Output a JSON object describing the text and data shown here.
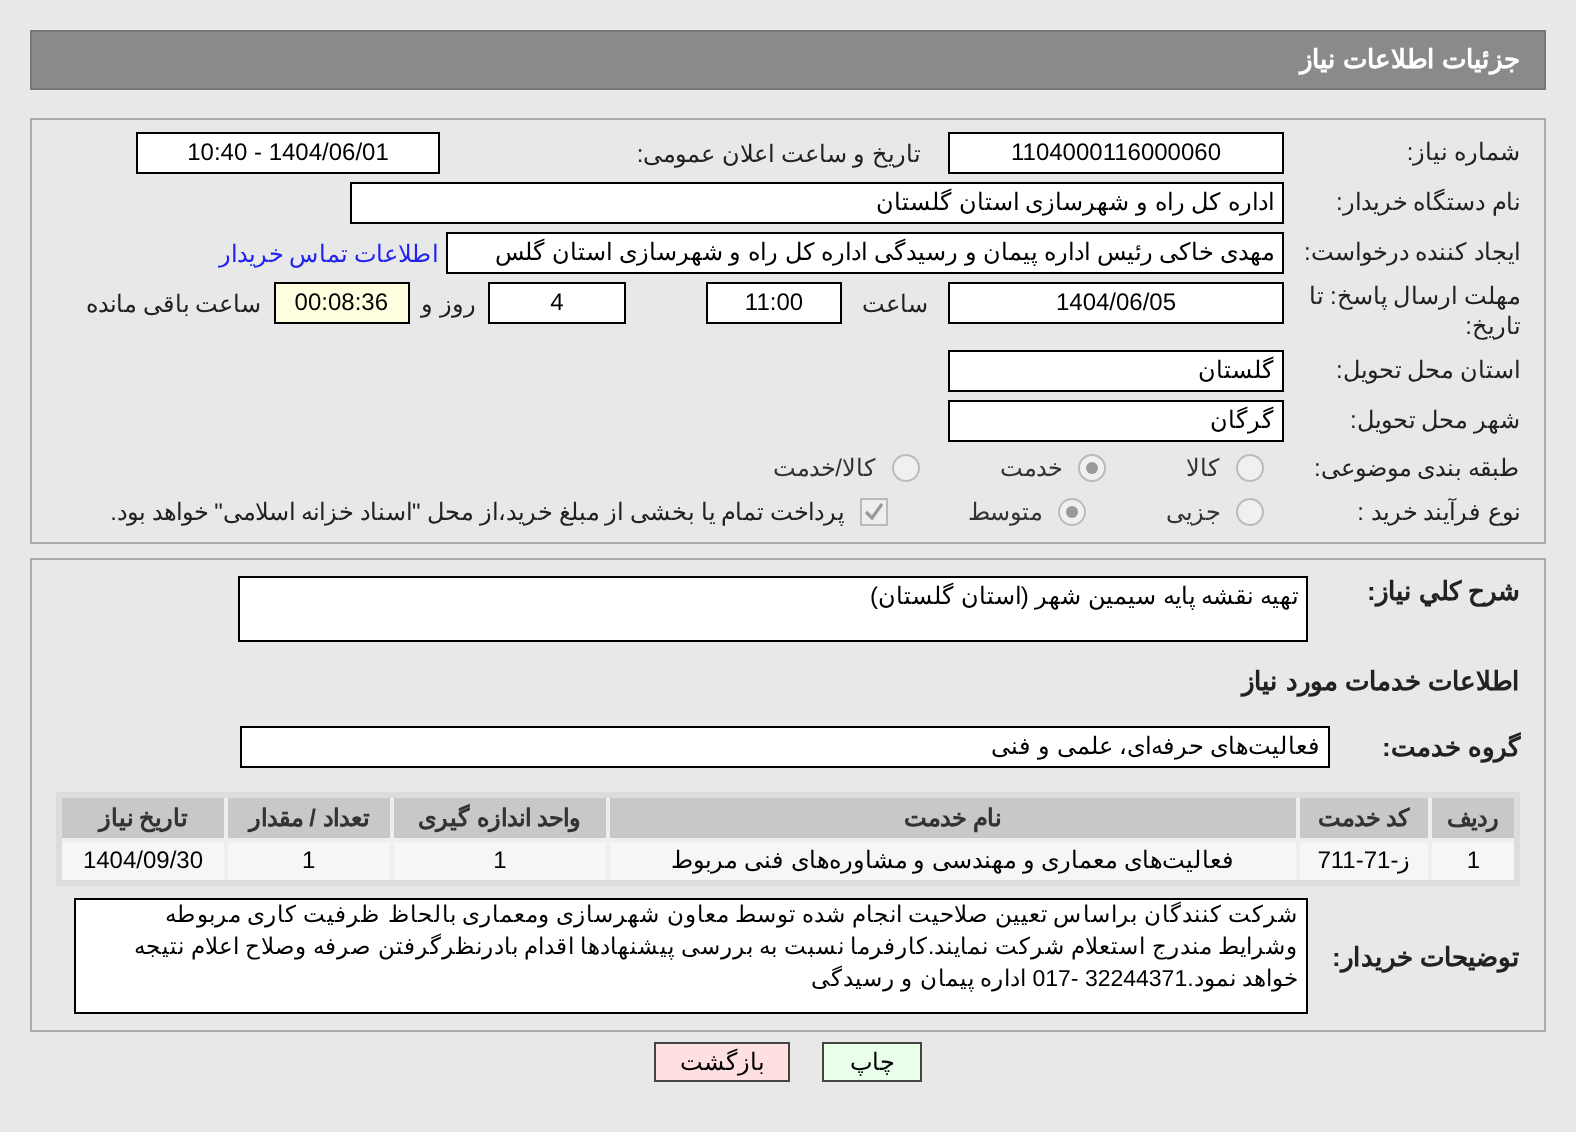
{
  "header": {
    "title": "جزئیات اطلاعات نیاز"
  },
  "need_number": {
    "label": "شماره نیاز:",
    "value": "1104000116000060"
  },
  "announce": {
    "label": "تاریخ و ساعت اعلان عمومی:",
    "value": "1404/06/01 - 10:40"
  },
  "buyer_org": {
    "label": "نام دستگاه خریدار:",
    "value": "اداره کل راه و شهرسازی استان گلستان"
  },
  "requester": {
    "label": "ایجاد کننده درخواست:",
    "value": "مهدی خاکی رئیس اداره پیمان و رسیدگی اداره کل راه و شهرسازی استان گلس",
    "link": "اطلاعات تماس خریدار"
  },
  "deadline": {
    "label": "مهلت ارسال پاسخ: تا تاریخ:",
    "date": "1404/06/05",
    "time_label": "ساعت",
    "time": "11:00",
    "days": "4",
    "days_label": "روز و",
    "remaining": "00:08:36",
    "remaining_label": "ساعت باقی مانده"
  },
  "province": {
    "label": "استان محل تحویل:",
    "value": "گلستان"
  },
  "city": {
    "label": "شهر محل تحویل:",
    "value": "گرگان"
  },
  "category": {
    "label": "طبقه بندی موضوعی:",
    "options": [
      {
        "label": "کالا",
        "selected": false
      },
      {
        "label": "خدمت",
        "selected": true
      },
      {
        "label": "کالا/خدمت",
        "selected": false
      }
    ]
  },
  "process": {
    "label": "نوع فرآیند خرید :",
    "options": [
      {
        "label": "جزیی",
        "selected": false
      },
      {
        "label": "متوسط",
        "selected": true
      }
    ],
    "payment": {
      "checked": true,
      "label": "پرداخت تمام یا بخشی از مبلغ خرید،از محل \"اسناد خزانه اسلامی\" خواهد بود."
    }
  },
  "description": {
    "label": "شرح کلي نياز:",
    "value": "تهیه نقشه پایه سیمین شهر (استان گلستان)"
  },
  "services_heading": "اطلاعات خدمات مورد نیاز",
  "service_group": {
    "label": "گروه خدمت:",
    "value": "فعالیت‌های حرفه‌ای، علمی و فنی"
  },
  "table": {
    "columns": [
      "ردیف",
      "کد خدمت",
      "نام خدمت",
      "واحد اندازه گیری",
      "تعداد / مقدار",
      "تاریخ نیاز"
    ],
    "rows": [
      [
        "1",
        "ز-71-711",
        "فعالیت‌های معماری و مهندسی و مشاوره‌های فنی مربوط",
        "1",
        "1",
        "1404/09/30"
      ]
    ]
  },
  "buyer_notes": {
    "label": "توضیحات خریدار:",
    "value": "شرکت کنندگان براساس تعیین صلاحیت انجام شده توسط معاون شهرسازی ومعماری بالحاظ ظرفیت کاری مربوطه وشرایط مندرج استعلام شرکت نمایند.کارفرما نسبت به بررسی پیشنهادها اقدام بادرنظرگرفتن صرفه وصلاح اعلام نتیجه خواهد نمود.32244371 -017 اداره پیمان و رسیدگی"
  },
  "buttons": [
    {
      "label": "چاپ",
      "kind": "print"
    },
    {
      "label": "بازگشت",
      "kind": "back"
    }
  ]
}
